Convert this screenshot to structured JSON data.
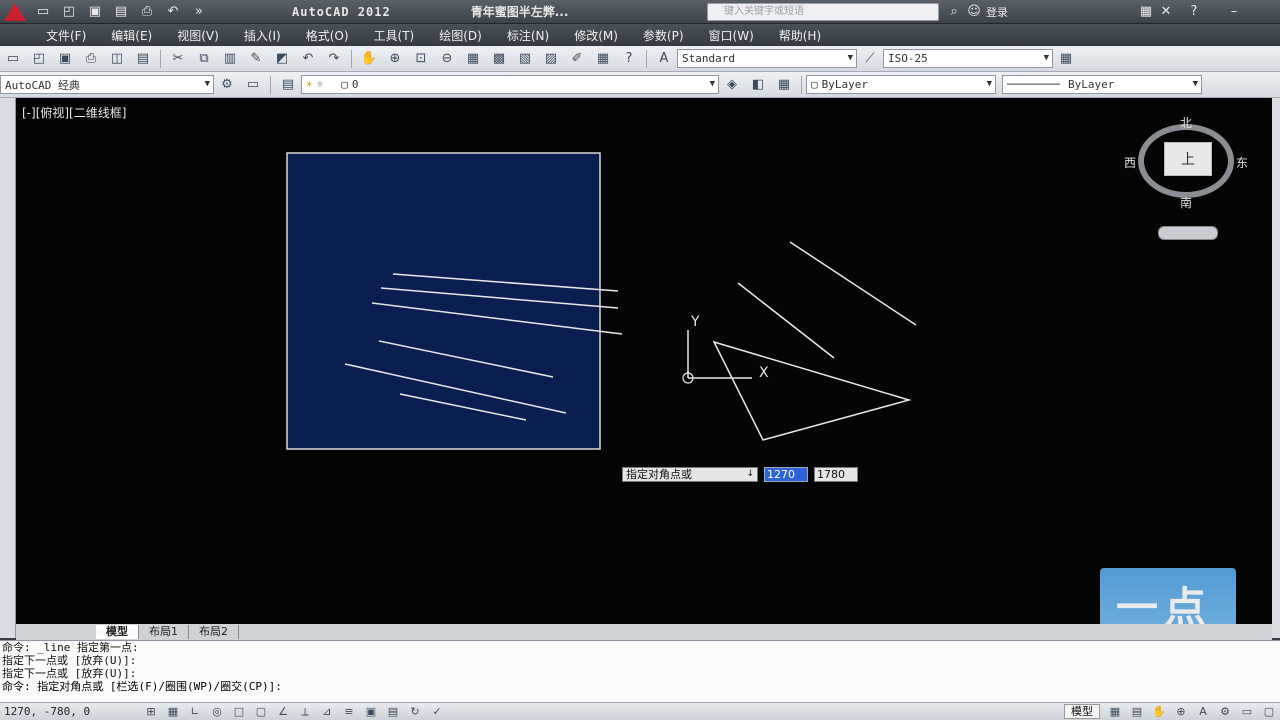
{
  "titlebar": {
    "app_title": "AutoCAD 2012",
    "doc_title": "青年蜜图半左弊...",
    "search_placeholder": "键入关键字或短语",
    "login_label": "登录"
  },
  "menu": {
    "items": [
      "文件(F)",
      "编辑(E)",
      "视图(V)",
      "插入(I)",
      "格式(O)",
      "工具(T)",
      "绘图(D)",
      "标注(N)",
      "修改(M)",
      "参数(P)",
      "窗口(W)",
      "帮助(H)"
    ]
  },
  "toolbar": {
    "text_style": "Standard",
    "dim_style": "ISO-25",
    "workspace": "AutoCAD 经典",
    "layer": "0",
    "color": "ByLayer",
    "linetype": "ByLayer"
  },
  "canvas": {
    "viewport_label": "[-][俯视][二维线框]",
    "background": "#050505",
    "rect_fill": "#0a1f4f",
    "line_color": "#e8e8e8"
  },
  "viewcube": {
    "north": "北",
    "south": "南",
    "east": "东",
    "west": "西",
    "face": "上"
  },
  "dynamic_input": {
    "prompt": "指定对角点或",
    "x_value": "1270",
    "y_value": "1780"
  },
  "ucs": {
    "y_label": "Y",
    "x_label": "X"
  },
  "watermark": {
    "text": "一点"
  },
  "tabs": {
    "items": [
      "模型",
      "布局1",
      "布局2"
    ],
    "active": "模型"
  },
  "command": {
    "lines": [
      "命令: _line 指定第一点:",
      "指定下一点或 [放弃(U)]:",
      "指定下一点或 [放弃(U)]:",
      "命令: 指定对角点或 [栏选(F)/圈围(WP)/圈交(CP)]:"
    ]
  },
  "status": {
    "coords": "1270, -780, 0",
    "model_label": "模型"
  }
}
